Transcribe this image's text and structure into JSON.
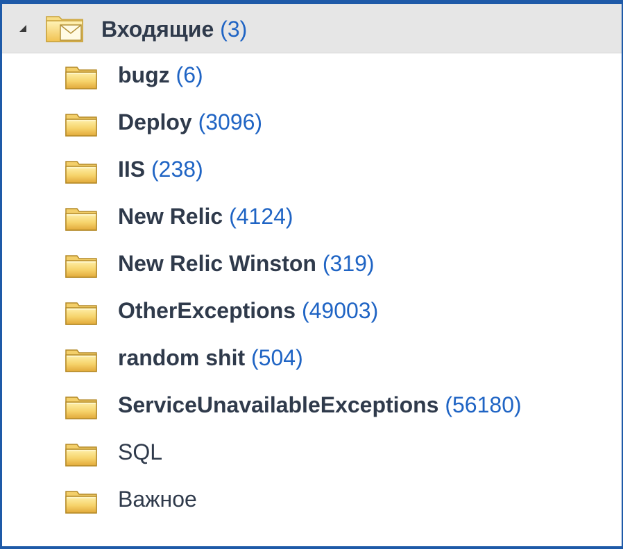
{
  "root": {
    "name": "Входящие",
    "count": "(3)",
    "icon": "inbox-folder-icon"
  },
  "folders": [
    {
      "name": "bugz",
      "count": "(6)",
      "unread": true
    },
    {
      "name": "Deploy",
      "count": "(3096)",
      "unread": true
    },
    {
      "name": "IIS",
      "count": "(238)",
      "unread": true
    },
    {
      "name": "New Relic",
      "count": "(4124)",
      "unread": true
    },
    {
      "name": "New Relic Winston",
      "count": "(319)",
      "unread": true
    },
    {
      "name": "OtherExceptions",
      "count": "(49003)",
      "unread": true
    },
    {
      "name": "random shit",
      "count": "(504)",
      "unread": true
    },
    {
      "name": "ServiceUnavailableExceptions",
      "count": "(56180)",
      "unread": true
    },
    {
      "name": "SQL",
      "count": "",
      "unread": false
    },
    {
      "name": "Важное",
      "count": "",
      "unread": false
    }
  ],
  "colors": {
    "frame": "#1e5aa8",
    "selected_row": "#e6e6e6",
    "text": "#2f3a4b",
    "count": "#1f64c4"
  }
}
